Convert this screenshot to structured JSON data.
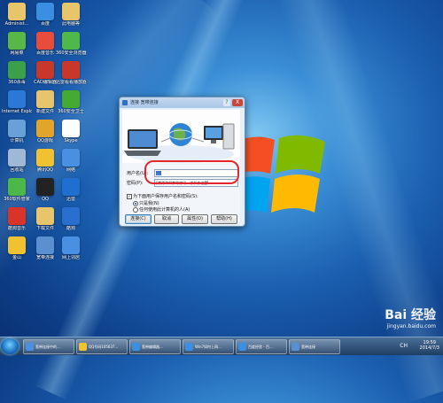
{
  "desktop_icons": [
    {
      "label": "Administ...",
      "color": "#e8c56a"
    },
    {
      "label": "百度",
      "color": "#3a8fe0"
    },
    {
      "label": "此电脑等",
      "color": "#e8c56a"
    },
    {
      "label": "网易菜",
      "color": "#57b847"
    },
    {
      "label": "百度音乐",
      "color": "#e84d3c"
    },
    {
      "label": "360安全浏览器",
      "color": "#4fb84a"
    },
    {
      "label": "360杀毒",
      "color": "#3aa04a"
    },
    {
      "label": "CAD编辑器",
      "color": "#c8382a"
    },
    {
      "label": "迅雷看看播放器",
      "color": "#c8382a"
    },
    {
      "label": "Internet Explorer",
      "color": "#2a7ad5"
    },
    {
      "label": "新建文件",
      "color": "#e8c56a"
    },
    {
      "label": "360安全卫士",
      "color": "#44aa33"
    },
    {
      "label": "计算机",
      "color": "#6aa0d8"
    },
    {
      "label": "QQ游戏",
      "color": "#e0a52a"
    },
    {
      "label": "Skype",
      "color": "#ffffff"
    },
    {
      "label": "回收站",
      "color": "#9fb9d4"
    },
    {
      "label": "腾讯QQ",
      "color": "#f0c232"
    },
    {
      "label": "网络",
      "color": "#4a90e2"
    },
    {
      "label": "360软件管家",
      "color": "#4cb84a"
    },
    {
      "label": "QQ",
      "color": "#222222"
    },
    {
      "label": "迅雷",
      "color": "#1f6fd0"
    },
    {
      "label": "酷狗音乐",
      "color": "#d9342a"
    },
    {
      "label": "下载文件",
      "color": "#e8c56a"
    },
    {
      "label": "酷狗",
      "color": "#2a6fd0"
    },
    {
      "label": "金山",
      "color": "#f0c232"
    },
    {
      "label": "宽带连接",
      "color": "#5a8fd0"
    },
    {
      "label": "网上邻居",
      "color": "#4a90e2"
    }
  ],
  "dialog": {
    "title": "连接 宽带连接",
    "help": "?",
    "close": "X",
    "username_label": "用户名(U):",
    "username_value": "...",
    "password_label": "密码(P):",
    "password_placeholder": "[要更改保存的密码，请单击这里]",
    "save_checkbox": "为下面用户保存用户名和密码(S):",
    "radio_me": "只是我(N)",
    "radio_anyone": "任何使用此计算机的人(A)",
    "buttons": {
      "connect": "连接(C)",
      "cancel": "取消",
      "properties": "属性(O)",
      "help": "帮助(H)"
    }
  },
  "taskbar": {
    "tasks": [
      {
        "label": "宽带连接中的...",
        "color": "#4a90e2"
      },
      {
        "label": "QQ号码105637...",
        "color": "#f0c232"
      },
      {
        "label": "宽带编辑器...",
        "color": "#3a8fe0"
      },
      {
        "label": "Win7如何上网...",
        "color": "#3a8fe0"
      },
      {
        "label": "百度经验 - 百...",
        "color": "#3a8fe0"
      },
      {
        "label": "宽带连接",
        "color": "#5a8fd0"
      }
    ],
    "time": "19:59",
    "date": "2014/7/3",
    "tray": "CH"
  },
  "watermark": {
    "brand": "Bai 经验",
    "url": "jingyan.baidu.com"
  }
}
